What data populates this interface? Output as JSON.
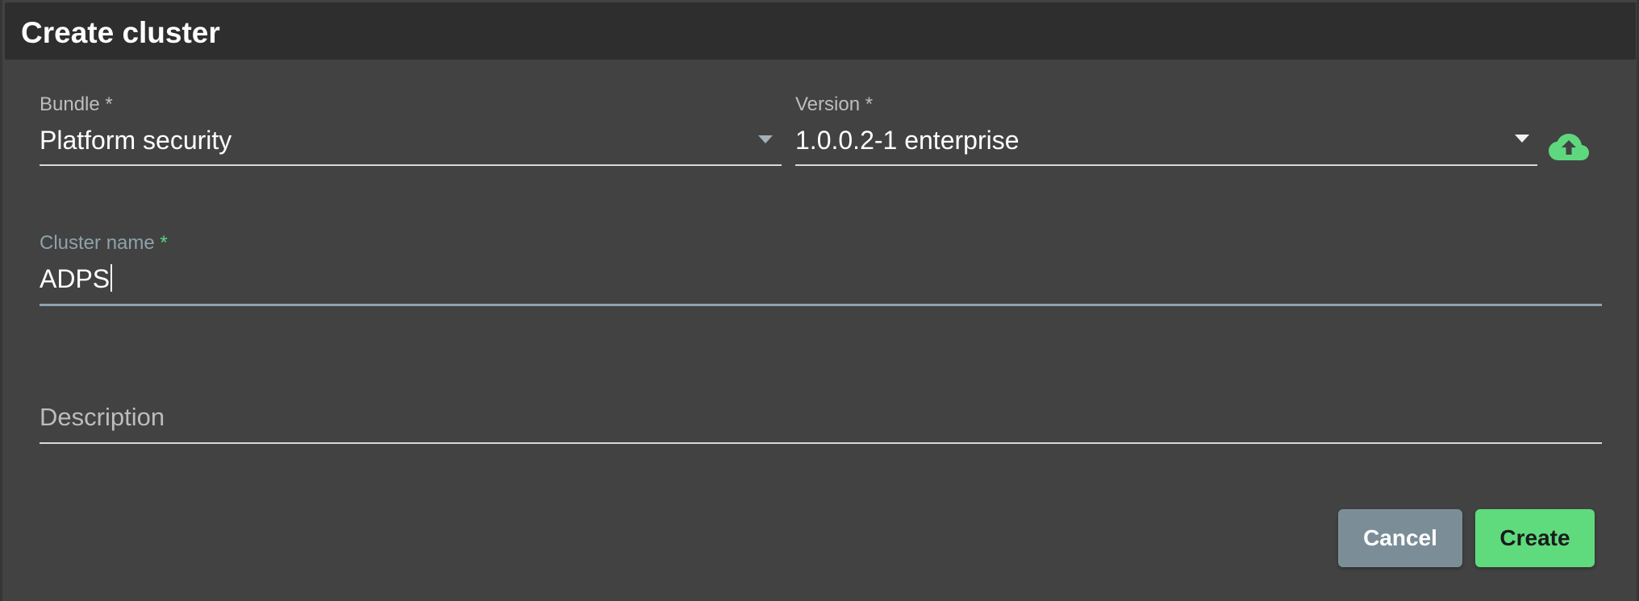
{
  "dialog": {
    "title": "Create cluster"
  },
  "form": {
    "bundle": {
      "label": "Bundle *",
      "value": "Platform security",
      "icon": "chevron-down-icon"
    },
    "version": {
      "label": "Version *",
      "value": "1.0.0.2-1 enterprise",
      "icon": "chevron-down-icon"
    },
    "upload": {
      "icon": "cloud-upload-icon",
      "color": "#5fd77f"
    },
    "cluster_name": {
      "label": "Cluster name",
      "required": "*",
      "value": "ADPS"
    },
    "description": {
      "placeholder": "Description",
      "value": ""
    }
  },
  "actions": {
    "cancel_label": "Cancel",
    "create_label": "Create"
  },
  "colors": {
    "background": "#424242",
    "titlebar": "#2e2e2e",
    "accent": "#5fdb7e",
    "secondary_button": "#7b8e98",
    "focused_field": "#8ea3ad"
  }
}
